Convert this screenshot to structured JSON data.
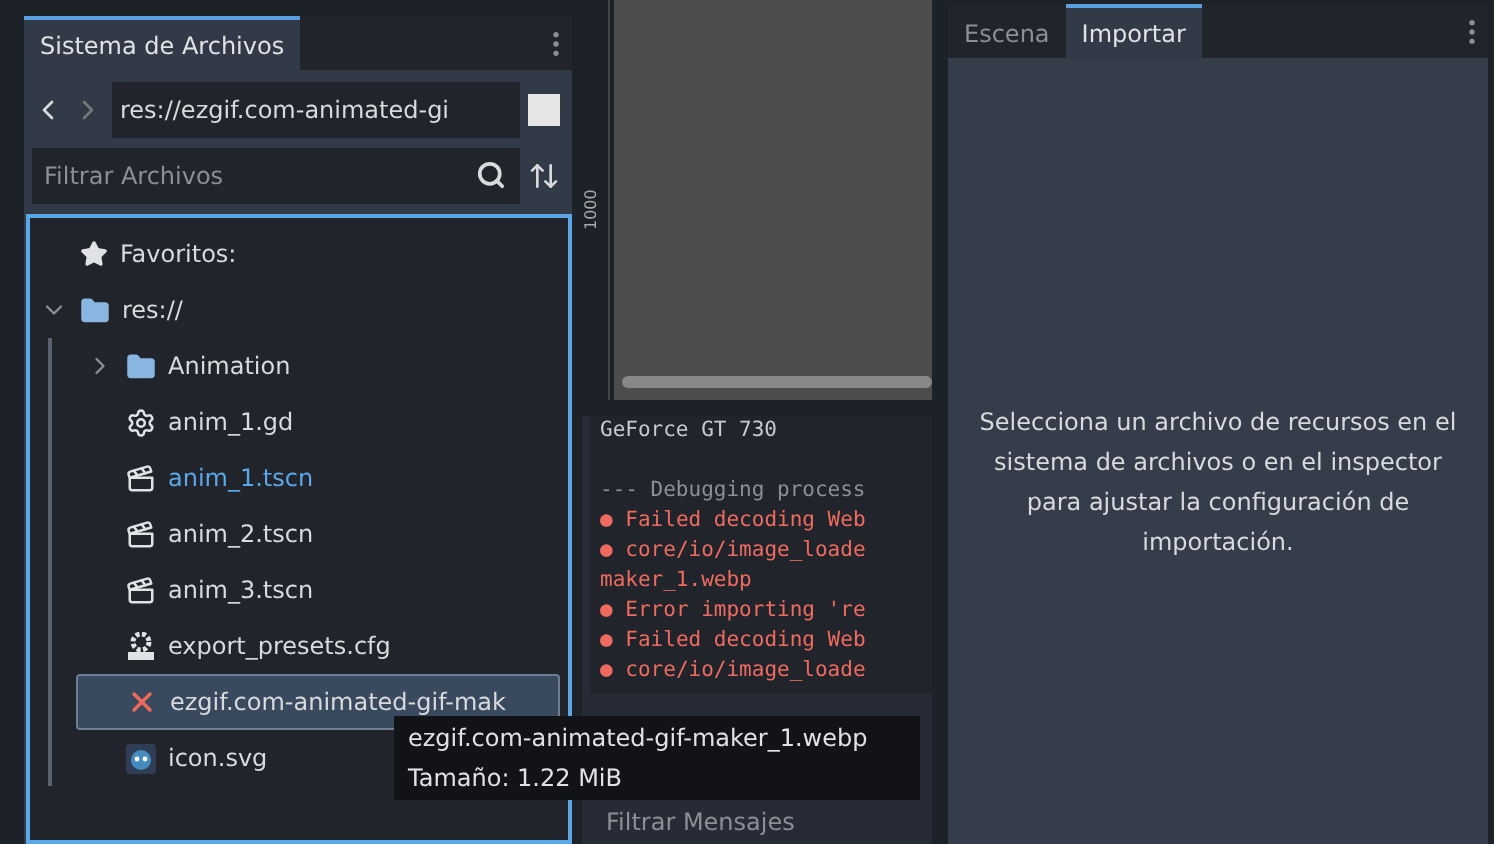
{
  "filesystem": {
    "tab": {
      "label": "Sistema de Archivos",
      "selected": true
    },
    "path": {
      "value": "res://ezgif.com-animated-gi"
    },
    "filter": {
      "placeholder": "Filtrar Archivos"
    },
    "tree": [
      {
        "label": "Favoritos:",
        "kind": "favorites",
        "selected": false,
        "active": false
      },
      {
        "label": "res://",
        "kind": "folder",
        "expanded": true,
        "selected": false,
        "active": false,
        "children": [
          {
            "label": "Animation",
            "kind": "folder",
            "expanded": false,
            "selected": false,
            "active": false
          },
          {
            "label": "anim_1.gd",
            "kind": "script",
            "selected": false,
            "active": false
          },
          {
            "label": "anim_1.tscn",
            "kind": "scene",
            "selected": false,
            "active": true
          },
          {
            "label": "anim_2.tscn",
            "kind": "scene",
            "selected": false,
            "active": false
          },
          {
            "label": "anim_3.tscn",
            "kind": "scene",
            "selected": false,
            "active": false
          },
          {
            "label": "export_presets.cfg",
            "kind": "config",
            "selected": false,
            "active": false
          },
          {
            "label": "ezgif.com-animated-gif-mak",
            "kind": "error",
            "selected": true,
            "active": false
          },
          {
            "label": "icon.svg",
            "kind": "image",
            "selected": false,
            "active": false
          }
        ]
      }
    ]
  },
  "viewport": {
    "ruler_label": "1000"
  },
  "console": {
    "lines": [
      {
        "kind": "plain",
        "text": "GeForce GT 730"
      },
      {
        "kind": "muted",
        "text": "--- Debugging process"
      },
      {
        "kind": "error",
        "bullet": "●",
        "text": "Failed decoding Web"
      },
      {
        "kind": "error",
        "bullet": "●",
        "text": "core/io/image_loade"
      },
      {
        "kind": "continuation",
        "text": "maker_1.webp"
      },
      {
        "kind": "error",
        "bullet": "●",
        "text": "Error importing 're"
      },
      {
        "kind": "error",
        "bullet": "●",
        "text": "Failed decoding Web"
      },
      {
        "kind": "error",
        "bullet": "●",
        "text": "core/io/image_loade"
      }
    ],
    "filter": {
      "placeholder": "Filtrar Mensajes"
    }
  },
  "tooltip": {
    "lines": [
      "ezgif.com-animated-gif-maker_1.webp",
      "Tamaño: 1.22 MiB"
    ]
  },
  "import_panel": {
    "tabs": [
      {
        "label": "Escena",
        "selected": false
      },
      {
        "label": "Importar",
        "selected": true
      }
    ],
    "message": "Selecciona un archivo de recursos en el sistema de archivos o en el inspector para ajustar la configuración de importación."
  }
}
